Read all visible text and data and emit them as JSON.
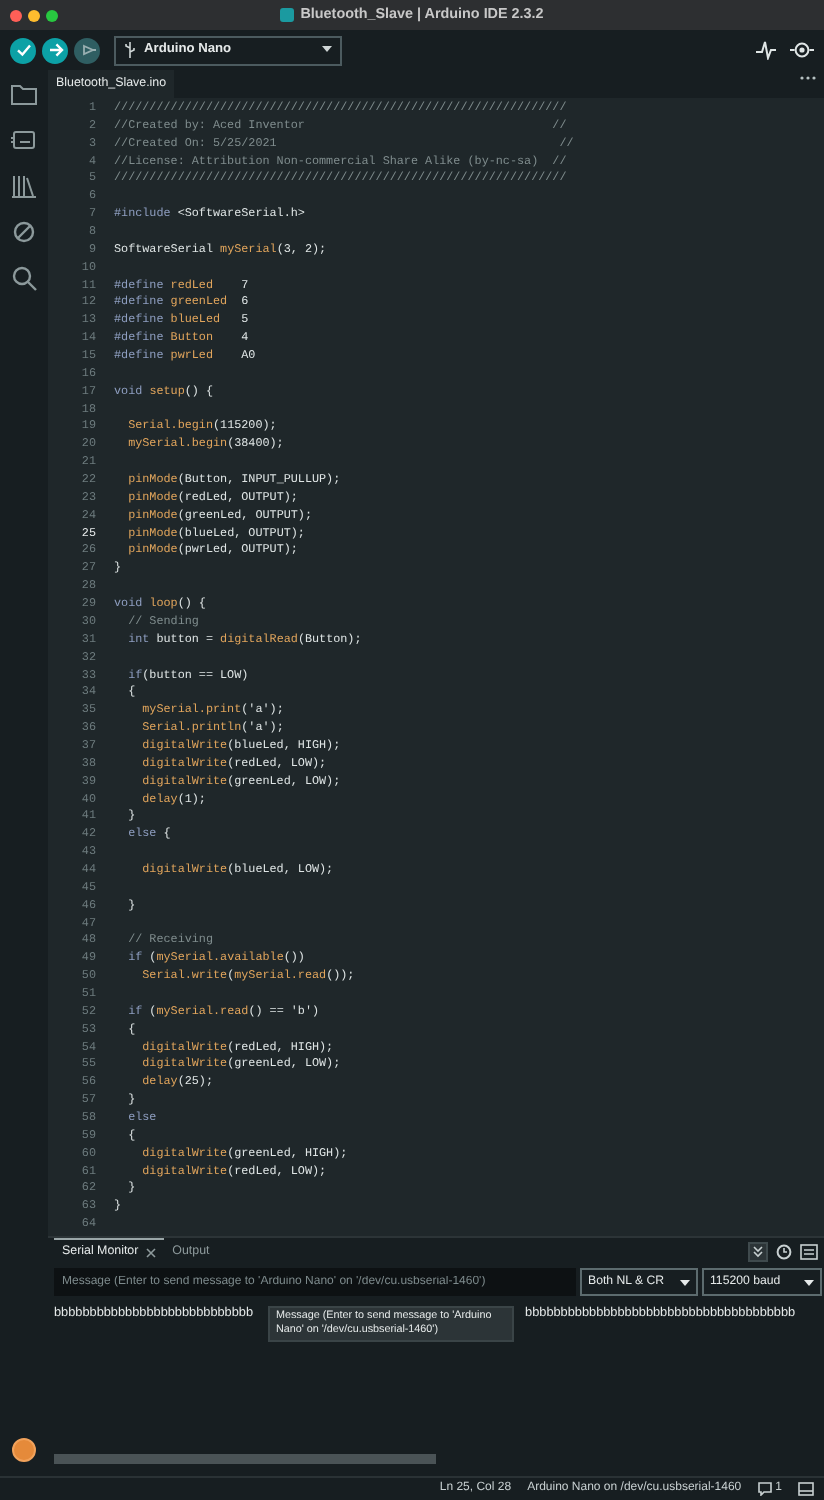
{
  "window": {
    "title": "Bluetooth_Slave | Arduino IDE 2.3.2"
  },
  "toolbar": {
    "board": "Arduino Nano"
  },
  "editor_tabs": [
    {
      "label": "Bluetooth_Slave.ino",
      "selected": true
    }
  ],
  "editor": {
    "lines": [
      {
        "number": "1",
        "current": false,
        "tokens": [
          {
            "kind": "comment",
            "text": "////////////////////////////////////////////////////////////////"
          }
        ]
      },
      {
        "number": "2",
        "current": false,
        "tokens": [
          {
            "kind": "comment",
            "text": "//Created by: Aced Inventor                                   //"
          }
        ]
      },
      {
        "number": "3",
        "current": false,
        "tokens": [
          {
            "kind": "comment",
            "text": "//Created On: 5/25/2021                                        //"
          }
        ]
      },
      {
        "number": "4",
        "current": false,
        "tokens": [
          {
            "kind": "comment",
            "text": "//License: Attribution Non-commercial Share Alike (by-nc-sa)  //"
          }
        ]
      },
      {
        "number": "5",
        "current": false,
        "tokens": [
          {
            "kind": "comment",
            "text": "////////////////////////////////////////////////////////////////"
          }
        ]
      },
      {
        "number": "6",
        "current": false
      },
      {
        "number": "7",
        "current": false,
        "tokens": [
          {
            "kind": "keyword",
            "text": "#include"
          },
          {
            "kind": "plain",
            "text": " <SoftwareSerial.h>"
          }
        ]
      },
      {
        "number": "8",
        "current": false
      },
      {
        "number": "9",
        "current": false,
        "tokens": [
          {
            "kind": "plain",
            "text": "SoftwareSerial "
          },
          {
            "kind": "name",
            "text": "mySerial"
          },
          {
            "kind": "plain",
            "text": "(3, 2);"
          }
        ]
      },
      {
        "number": "10",
        "current": false
      },
      {
        "number": "11",
        "current": false,
        "tokens": [
          {
            "kind": "keyword",
            "text": "#define "
          },
          {
            "kind": "name",
            "text": "redLed"
          },
          {
            "kind": "plain",
            "text": "    7"
          }
        ]
      },
      {
        "number": "12",
        "current": false,
        "tokens": [
          {
            "kind": "keyword",
            "text": "#define "
          },
          {
            "kind": "name",
            "text": "greenLed"
          },
          {
            "kind": "plain",
            "text": "  6"
          }
        ]
      },
      {
        "number": "13",
        "current": false,
        "tokens": [
          {
            "kind": "keyword",
            "text": "#define "
          },
          {
            "kind": "name",
            "text": "blueLed"
          },
          {
            "kind": "plain",
            "text": "   5"
          }
        ]
      },
      {
        "number": "14",
        "current": false,
        "tokens": [
          {
            "kind": "keyword",
            "text": "#define "
          },
          {
            "kind": "name",
            "text": "Button"
          },
          {
            "kind": "plain",
            "text": "    4"
          }
        ]
      },
      {
        "number": "15",
        "current": false,
        "tokens": [
          {
            "kind": "keyword",
            "text": "#define "
          },
          {
            "kind": "name",
            "text": "pwrLed"
          },
          {
            "kind": "plain",
            "text": "    A0"
          }
        ]
      },
      {
        "number": "16",
        "current": false
      },
      {
        "number": "17",
        "current": false,
        "tokens": [
          {
            "kind": "keyword",
            "text": "void "
          },
          {
            "kind": "name",
            "text": "setup"
          },
          {
            "kind": "plain",
            "text": "() {"
          }
        ]
      },
      {
        "number": "18",
        "current": false
      },
      {
        "number": "19",
        "current": false,
        "tokens": [
          {
            "kind": "name",
            "text": "  Serial.begin"
          },
          {
            "kind": "plain",
            "text": "(115200);"
          }
        ]
      },
      {
        "number": "20",
        "current": false,
        "tokens": [
          {
            "kind": "name",
            "text": "  mySerial.begin"
          },
          {
            "kind": "plain",
            "text": "(38400);"
          }
        ]
      },
      {
        "number": "21",
        "current": false
      },
      {
        "number": "22",
        "current": false,
        "tokens": [
          {
            "kind": "name",
            "text": "  pinMode"
          },
          {
            "kind": "plain",
            "text": "(Button, INPUT_PULLUP);"
          }
        ]
      },
      {
        "number": "23",
        "current": false,
        "tokens": [
          {
            "kind": "name",
            "text": "  pinMode"
          },
          {
            "kind": "plain",
            "text": "(redLed, OUTPUT);"
          }
        ]
      },
      {
        "number": "24",
        "current": false,
        "tokens": [
          {
            "kind": "name",
            "text": "  pinMode"
          },
          {
            "kind": "plain",
            "text": "(greenLed, OUTPUT);"
          }
        ]
      },
      {
        "number": "25",
        "current": true,
        "tokens": [
          {
            "kind": "name",
            "text": "  pinMode"
          },
          {
            "kind": "plain",
            "text": "(blueLed, OUTPUT);"
          }
        ]
      },
      {
        "number": "26",
        "current": false,
        "tokens": [
          {
            "kind": "name",
            "text": "  pinMode"
          },
          {
            "kind": "plain",
            "text": "(pwrLed, OUTPUT);"
          }
        ]
      },
      {
        "number": "27",
        "current": false,
        "tokens": [
          {
            "kind": "plain",
            "text": "}"
          }
        ]
      },
      {
        "number": "28",
        "current": false
      },
      {
        "number": "29",
        "current": false,
        "tokens": [
          {
            "kind": "keyword",
            "text": "void "
          },
          {
            "kind": "name",
            "text": "loop"
          },
          {
            "kind": "plain",
            "text": "() {"
          }
        ]
      },
      {
        "number": "30",
        "current": false,
        "tokens": [
          {
            "kind": "comment",
            "text": "  // Sending"
          }
        ]
      },
      {
        "number": "31",
        "current": false,
        "tokens": [
          {
            "kind": "keyword",
            "text": "  int"
          },
          {
            "kind": "plain",
            "text": " button = "
          },
          {
            "kind": "name",
            "text": "digitalRead"
          },
          {
            "kind": "plain",
            "text": "(Button);"
          }
        ]
      },
      {
        "number": "32",
        "current": false
      },
      {
        "number": "33",
        "current": false,
        "tokens": [
          {
            "kind": "keyword",
            "text": "  if"
          },
          {
            "kind": "plain",
            "text": "(button == LOW)"
          }
        ]
      },
      {
        "number": "34",
        "current": false,
        "tokens": [
          {
            "kind": "plain",
            "text": "  {"
          }
        ]
      },
      {
        "number": "35",
        "current": false,
        "tokens": [
          {
            "kind": "name",
            "text": "    mySerial.print"
          },
          {
            "kind": "plain",
            "text": "('a');"
          }
        ]
      },
      {
        "number": "36",
        "current": false,
        "tokens": [
          {
            "kind": "name",
            "text": "    Serial.println"
          },
          {
            "kind": "plain",
            "text": "('a');"
          }
        ]
      },
      {
        "number": "37",
        "current": false,
        "tokens": [
          {
            "kind": "name",
            "text": "    digitalWrite"
          },
          {
            "kind": "plain",
            "text": "(blueLed, HIGH);"
          }
        ]
      },
      {
        "number": "38",
        "current": false,
        "tokens": [
          {
            "kind": "name",
            "text": "    digitalWrite"
          },
          {
            "kind": "plain",
            "text": "(redLed, LOW);"
          }
        ]
      },
      {
        "number": "39",
        "current": false,
        "tokens": [
          {
            "kind": "name",
            "text": "    digitalWrite"
          },
          {
            "kind": "plain",
            "text": "(greenLed, LOW);"
          }
        ]
      },
      {
        "number": "40",
        "current": false,
        "tokens": [
          {
            "kind": "name",
            "text": "    delay"
          },
          {
            "kind": "plain",
            "text": "(1);"
          }
        ]
      },
      {
        "number": "41",
        "current": false,
        "tokens": [
          {
            "kind": "plain",
            "text": "  }"
          }
        ]
      },
      {
        "number": "42",
        "current": false,
        "tokens": [
          {
            "kind": "keyword",
            "text": "  else"
          },
          {
            "kind": "plain",
            "text": " {"
          }
        ]
      },
      {
        "number": "43",
        "current": false
      },
      {
        "number": "44",
        "current": false,
        "tokens": [
          {
            "kind": "name",
            "text": "    digitalWrite"
          },
          {
            "kind": "plain",
            "text": "(blueLed, LOW);"
          }
        ]
      },
      {
        "number": "45",
        "current": false
      },
      {
        "number": "46",
        "current": false,
        "tokens": [
          {
            "kind": "plain",
            "text": "  }"
          }
        ]
      },
      {
        "number": "47",
        "current": false
      },
      {
        "number": "48",
        "current": false,
        "tokens": [
          {
            "kind": "comment",
            "text": "  // Receiving"
          }
        ]
      },
      {
        "number": "49",
        "current": false,
        "tokens": [
          {
            "kind": "keyword",
            "text": "  if"
          },
          {
            "kind": "plain",
            "text": " ("
          },
          {
            "kind": "name",
            "text": "mySerial.available"
          },
          {
            "kind": "plain",
            "text": "())"
          }
        ]
      },
      {
        "number": "50",
        "current": false,
        "tokens": [
          {
            "kind": "name",
            "text": "    Serial.write"
          },
          {
            "kind": "plain",
            "text": "("
          },
          {
            "kind": "name",
            "text": "mySerial.read"
          },
          {
            "kind": "plain",
            "text": "());"
          }
        ]
      },
      {
        "number": "51",
        "current": false
      },
      {
        "number": "52",
        "current": false,
        "tokens": [
          {
            "kind": "keyword",
            "text": "  if"
          },
          {
            "kind": "plain",
            "text": " ("
          },
          {
            "kind": "name",
            "text": "mySerial.read"
          },
          {
            "kind": "plain",
            "text": "() == 'b')"
          }
        ]
      },
      {
        "number": "53",
        "current": false,
        "tokens": [
          {
            "kind": "plain",
            "text": "  {"
          }
        ]
      },
      {
        "number": "54",
        "current": false,
        "tokens": [
          {
            "kind": "name",
            "text": "    digitalWrite"
          },
          {
            "kind": "plain",
            "text": "(redLed, HIGH);"
          }
        ]
      },
      {
        "number": "55",
        "current": false,
        "tokens": [
          {
            "kind": "name",
            "text": "    digitalWrite"
          },
          {
            "kind": "plain",
            "text": "(greenLed, LOW);"
          }
        ]
      },
      {
        "number": "56",
        "current": false,
        "tokens": [
          {
            "kind": "name",
            "text": "    delay"
          },
          {
            "kind": "plain",
            "text": "(25);"
          }
        ]
      },
      {
        "number": "57",
        "current": false,
        "tokens": [
          {
            "kind": "plain",
            "text": "  }"
          }
        ]
      },
      {
        "number": "58",
        "current": false,
        "tokens": [
          {
            "kind": "keyword",
            "text": "  else"
          }
        ]
      },
      {
        "number": "59",
        "current": false,
        "tokens": [
          {
            "kind": "plain",
            "text": "  {"
          }
        ]
      },
      {
        "number": "60",
        "current": false,
        "tokens": [
          {
            "kind": "name",
            "text": "    digitalWrite"
          },
          {
            "kind": "plain",
            "text": "(greenLed, HIGH);"
          }
        ]
      },
      {
        "number": "61",
        "current": false,
        "tokens": [
          {
            "kind": "name",
            "text": "    digitalWrite"
          },
          {
            "kind": "plain",
            "text": "(redLed, LOW);"
          }
        ]
      },
      {
        "number": "62",
        "current": false,
        "tokens": [
          {
            "kind": "plain",
            "text": "  }"
          }
        ]
      },
      {
        "number": "63",
        "current": false,
        "tokens": [
          {
            "kind": "plain",
            "text": "}"
          }
        ]
      },
      {
        "number": "64",
        "current": false
      }
    ]
  },
  "panel": {
    "tabs": [
      {
        "label": "Serial Monitor",
        "selected": true,
        "closable": true
      },
      {
        "label": "Output",
        "selected": false,
        "closable": false
      }
    ],
    "autoscroll_on": true,
    "message_placeholder": "Message (Enter to send message to 'Arduino Nano' on '/dev/cu.usbserial-1460')",
    "line_ending": "Both NL & CR",
    "baud_rate": "115200 baud",
    "output_left": "bbbbbbbbbbbbbbbbbbbbbbbbbbbb",
    "output_right": "bbbbbbbbbbbbbbbbbbbbbbbbbbbbbbbbbbbbbb",
    "tooltip": "Message (Enter to send message to 'Arduino Nano' on '/dev/cu.usbserial-1460')"
  },
  "status_bar": {
    "position": "Ln 25, Col 28",
    "connection": "Arduino Nano on /dev/cu.usbserial-1460",
    "notifications": "1"
  }
}
